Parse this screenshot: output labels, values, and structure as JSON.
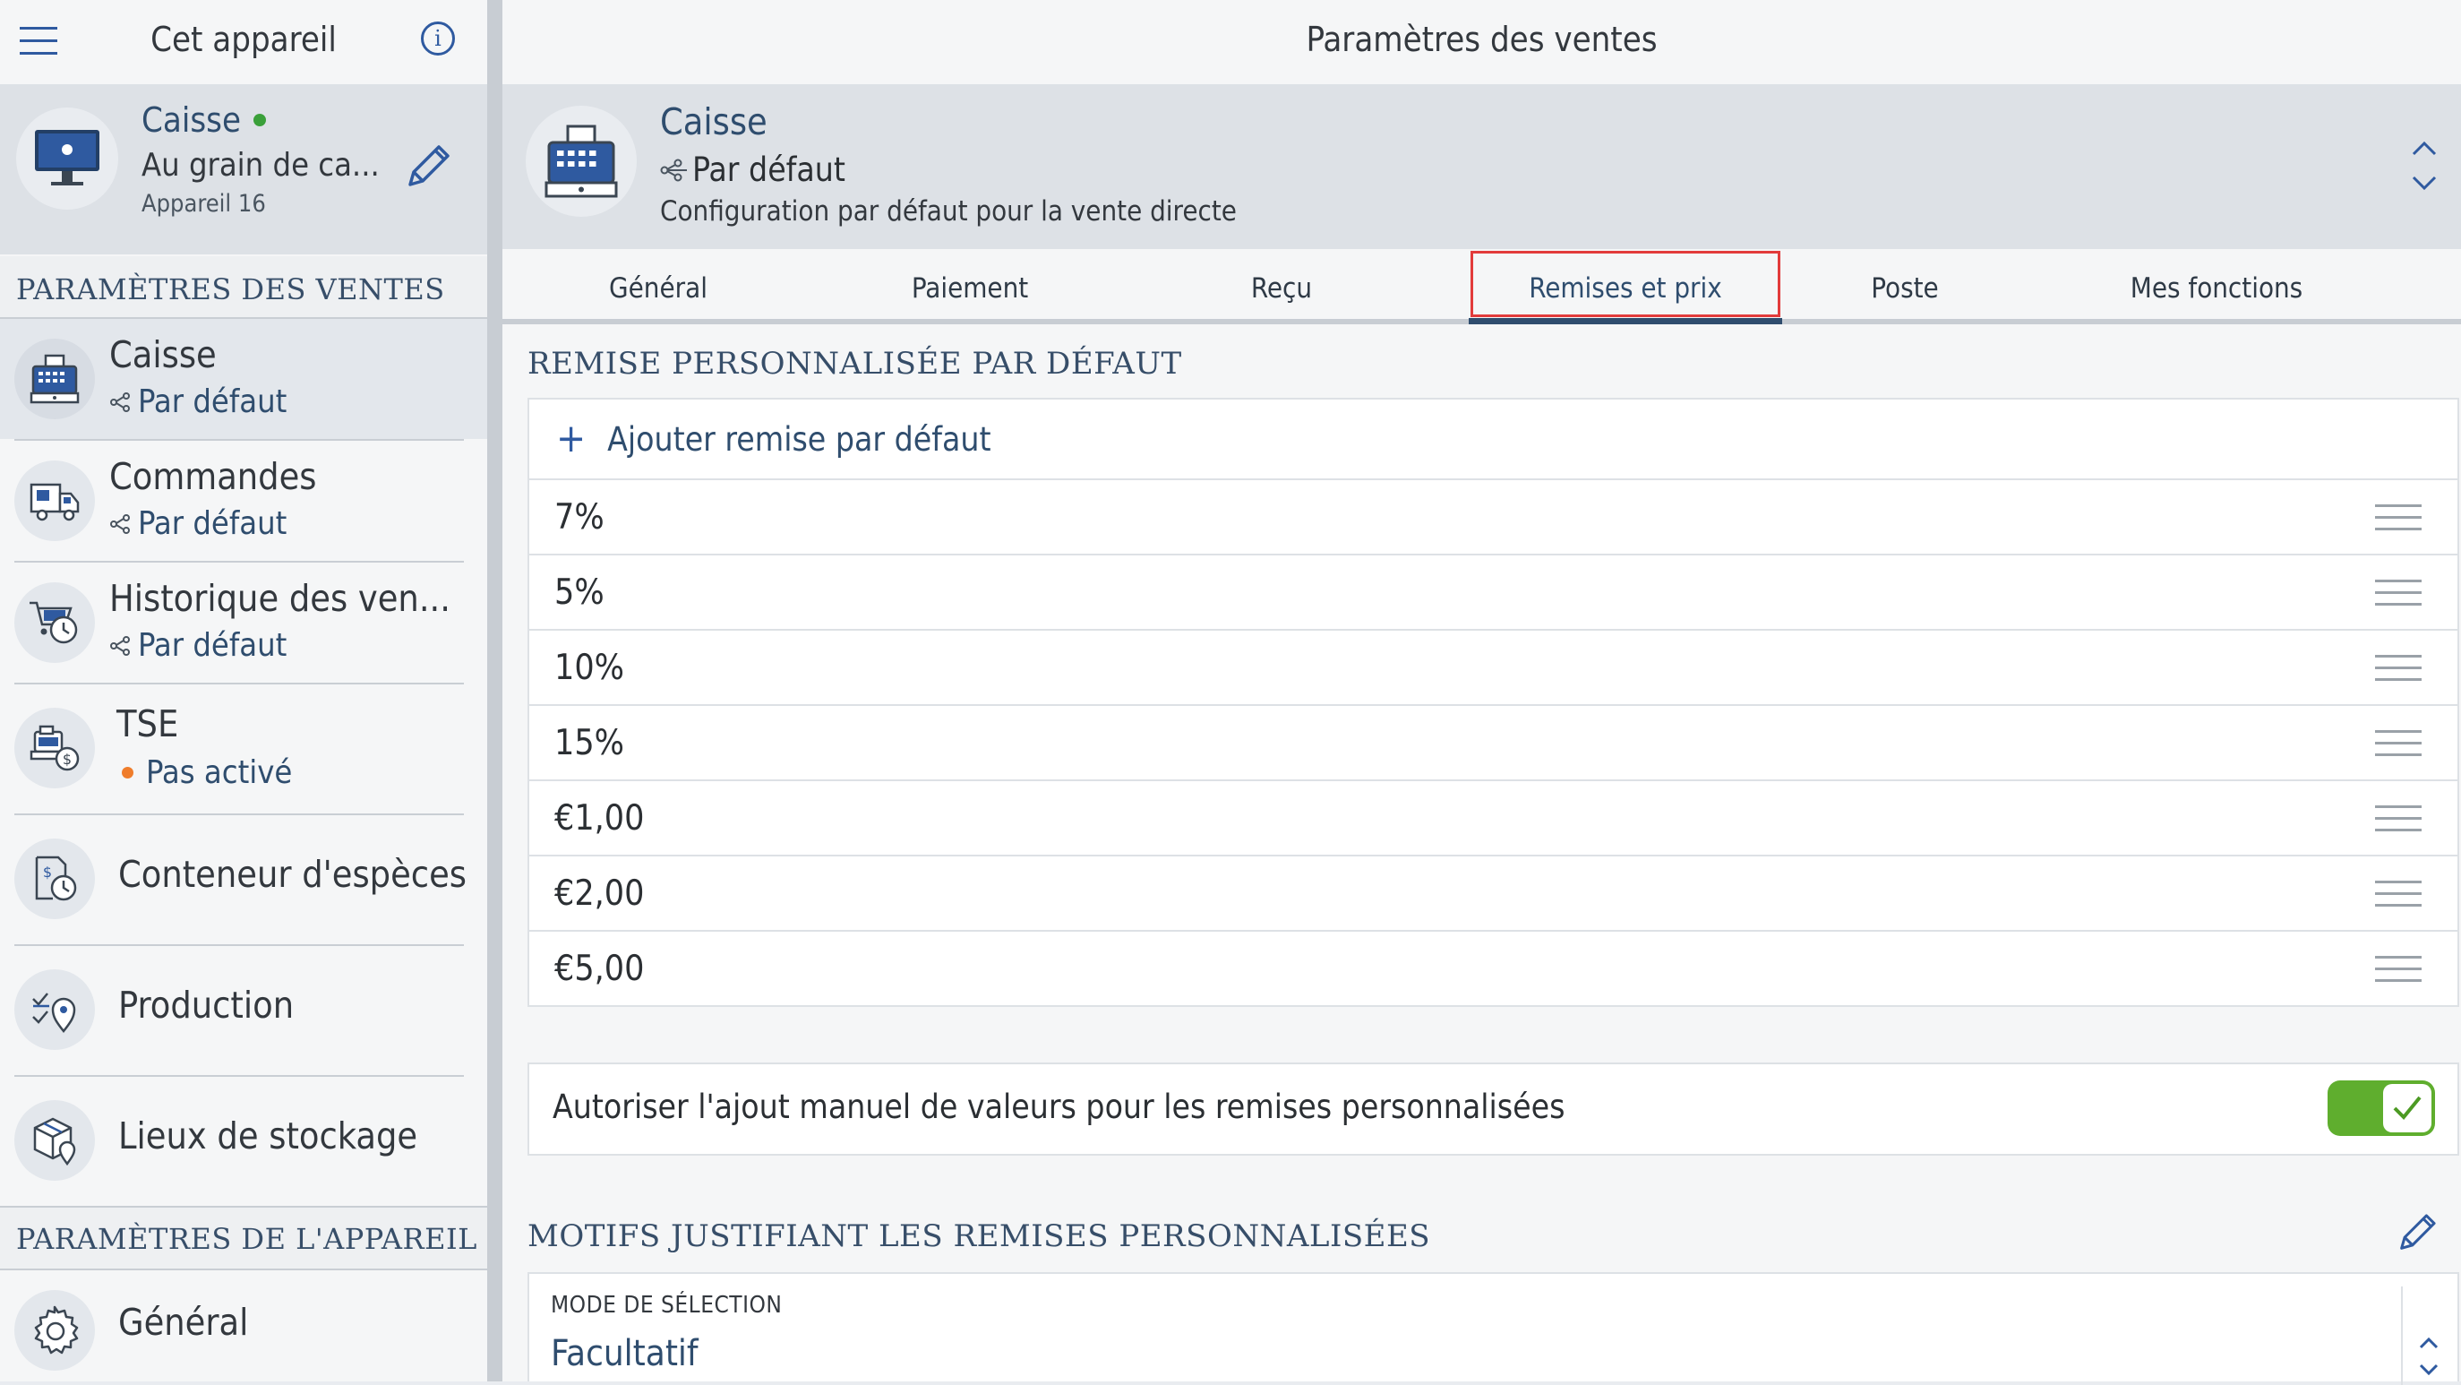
{
  "sidebar": {
    "header_title": "Cet appareil",
    "device": {
      "name": "Caisse",
      "status": "online",
      "location": "Au grain de ca...",
      "id_label": "Appareil 16"
    },
    "section_sales": "PARAMÈTRES DES VENTES",
    "items": [
      {
        "title": "Caisse",
        "sub": "Par défaut",
        "sub_type": "link",
        "icon": "cash-register-icon",
        "selected": true
      },
      {
        "title": "Commandes",
        "sub": "Par défaut",
        "sub_type": "link",
        "icon": "delivery-truck-icon"
      },
      {
        "title": "Historique des ven...",
        "sub": "Par défaut",
        "sub_type": "link",
        "icon": "sales-history-icon"
      },
      {
        "title": "TSE",
        "sub": "Pas activé",
        "sub_type": "status-dot",
        "icon": "tse-icon"
      },
      {
        "title": "Conteneur d'espèces",
        "icon": "cash-drawer-icon"
      },
      {
        "title": "Production",
        "icon": "production-icon"
      },
      {
        "title": "Lieux de stockage",
        "icon": "storage-icon"
      }
    ],
    "section_device": "PARAMÈTRES DE L'APPAREIL",
    "device_items": [
      {
        "title": "Général",
        "icon": "gear-icon"
      }
    ]
  },
  "main": {
    "header_title": "Paramètres des ventes",
    "profile": {
      "title": "Caisse",
      "subtitle": "Par défaut",
      "description": "Configuration par défaut pour la vente directe"
    },
    "tabs": [
      "Général",
      "Paiement",
      "Reçu",
      "Remises et prix",
      "Poste",
      "Mes fonctions"
    ],
    "active_tab": 3,
    "discounts": {
      "section_title": "REMISE PERSONNALISÉE PAR DÉFAUT",
      "add_label": "Ajouter remise par défaut",
      "values": [
        "7%",
        "5%",
        "10%",
        "15%",
        "€1,00",
        "€2,00",
        "€5,00"
      ]
    },
    "manual_toggle": {
      "label": "Autoriser l'ajout manuel de valeurs pour les remises personnalisées",
      "on": true
    },
    "reasons": {
      "section_title": "MOTIFS JUSTIFIANT LES REMISES PERSONNALISÉES",
      "mode_label": "MODE DE SÉLECTION",
      "mode_value": "Facultatif"
    }
  },
  "colors": {
    "accent": "#2f5aa0",
    "online": "#3aa03a",
    "inactive": "#ef7d2c",
    "toggle_on": "#5fae2e",
    "tab_highlight": "#e23b3b"
  }
}
